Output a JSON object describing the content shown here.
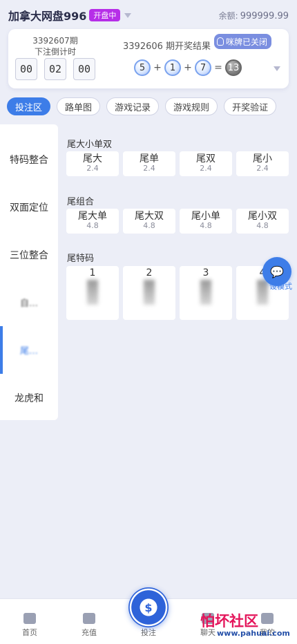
{
  "header": {
    "title": "加拿大网盘996",
    "status": "开盘中",
    "balance_label": "余额:",
    "balance_value": "999999.99"
  },
  "draw": {
    "current_period": "3392607期",
    "countdown_label": "下注倒计时",
    "timer": [
      "00",
      "02",
      "00"
    ],
    "last_result_title": "3392606 期开奖结果",
    "squeeze_button": "咪牌已关闭",
    "balls": [
      "5",
      "1",
      "7"
    ],
    "sum": "13",
    "plus": "+",
    "equals": "="
  },
  "tabs": [
    "投注区",
    "路单图",
    "游戏记录",
    "游戏规则",
    "开奖验证"
  ],
  "sidebar": {
    "items": [
      "特码整合",
      "双面定位",
      "三位整合",
      "自…",
      "尾…",
      "龙虎和"
    ]
  },
  "sections": {
    "big_small": {
      "title": "尾大小单双",
      "options": [
        {
          "name": "尾大",
          "odds": "2.4"
        },
        {
          "name": "尾单",
          "odds": "2.4"
        },
        {
          "name": "尾双",
          "odds": "2.4"
        },
        {
          "name": "尾小",
          "odds": "2.4"
        }
      ]
    },
    "combo": {
      "title": "尾组合",
      "options": [
        {
          "name": "尾大单",
          "odds": "4.8"
        },
        {
          "name": "尾大双",
          "odds": "4.8"
        },
        {
          "name": "尾小单",
          "odds": "4.8"
        },
        {
          "name": "尾小双",
          "odds": "4.8"
        }
      ]
    },
    "digits": {
      "title": "尾特码",
      "options": [
        "1",
        "2",
        "3",
        "4"
      ]
    }
  },
  "floating": {
    "mode_label": "设模式"
  },
  "tabbar": {
    "items": [
      "首页",
      "充值",
      "投注",
      "聊天",
      "我的"
    ]
  },
  "watermark": {
    "text": "怕坏社区",
    "url": "www.pahuai.com"
  },
  "colors": {
    "accent": "#3d7de8",
    "status_pill": "#b62ee8"
  }
}
